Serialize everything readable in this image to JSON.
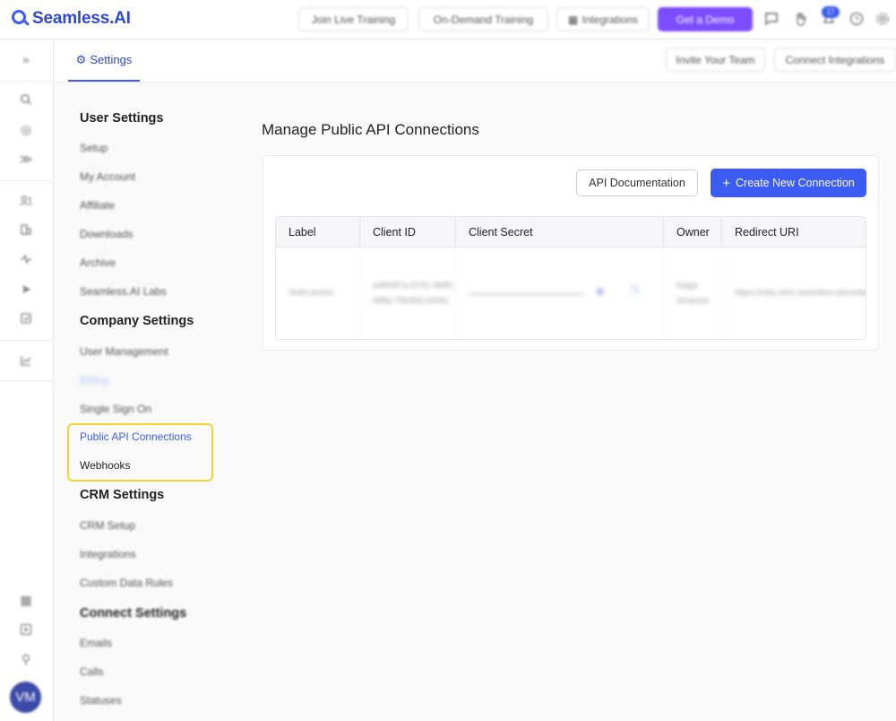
{
  "brand": {
    "name": "Seamless.AI"
  },
  "topbar": {
    "live_training": "Join Live Training",
    "on_demand": "On-Demand Training",
    "integrations": "Integrations",
    "get_demo": "Get a Demo",
    "notification_count": "17"
  },
  "user": {
    "initials": "VM"
  },
  "subheader": {
    "settings_tab": "Settings",
    "invite_team": "Invite Your Team",
    "connect_integrations": "Connect Integrations"
  },
  "sidebar": {
    "user_settings": {
      "heading": "User Settings",
      "items": [
        "Setup",
        "My Account",
        "Affiliate",
        "Downloads",
        "Archive",
        "Seamless.AI Labs"
      ]
    },
    "company_settings": {
      "heading": "Company Settings",
      "items": [
        "User Management",
        "Billing",
        "Single Sign On",
        "Public API Connections",
        "Webhooks"
      ]
    },
    "crm_settings": {
      "heading": "CRM Settings",
      "items": [
        "CRM Setup",
        "Integrations",
        "Custom Data Rules"
      ]
    },
    "connect_settings": {
      "heading": "Connect Settings",
      "items": [
        "Emails",
        "Calls",
        "Statuses"
      ]
    }
  },
  "main": {
    "title": "Manage Public API Connections",
    "api_doc_button": "API Documentation",
    "create_button": "Create New Connection",
    "table": {
      "headers": [
        "Label",
        "Client ID",
        "Client Secret",
        "Owner",
        "Redirect URI"
      ],
      "row": {
        "label": "Sethi postm",
        "client_id": "a4806f7a-6741-4680-b88a-79b3fdc16081",
        "owner": "Gaga Simpson",
        "redirect_uri": "https://odio.oirm.seamless.ai/credentials/callback"
      }
    }
  },
  "colors": {
    "accent": "#3b5bf2",
    "demo": "#7c4dff",
    "highlight": "#f5d22e"
  }
}
